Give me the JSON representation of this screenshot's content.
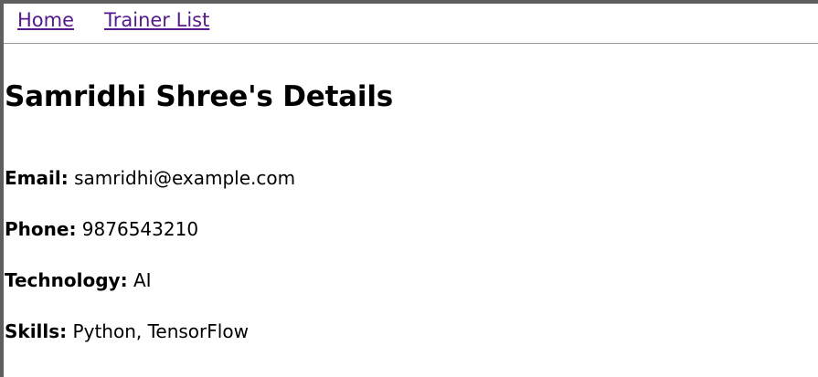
{
  "nav": {
    "home_label": "Home",
    "trainers_label": "Trainer List"
  },
  "page": {
    "title": "Samridhi Shree's Details"
  },
  "details": {
    "email": {
      "label": "Email:",
      "value": "samridhi@example.com"
    },
    "phone": {
      "label": "Phone:",
      "value": "9876543210"
    },
    "technology": {
      "label": "Technology:",
      "value": "AI"
    },
    "skills": {
      "label": "Skills:",
      "value": "Python, TensorFlow"
    }
  },
  "colors": {
    "link": "#551a8b",
    "frame": "#5f5f5f",
    "divider": "#9a9a9a"
  }
}
